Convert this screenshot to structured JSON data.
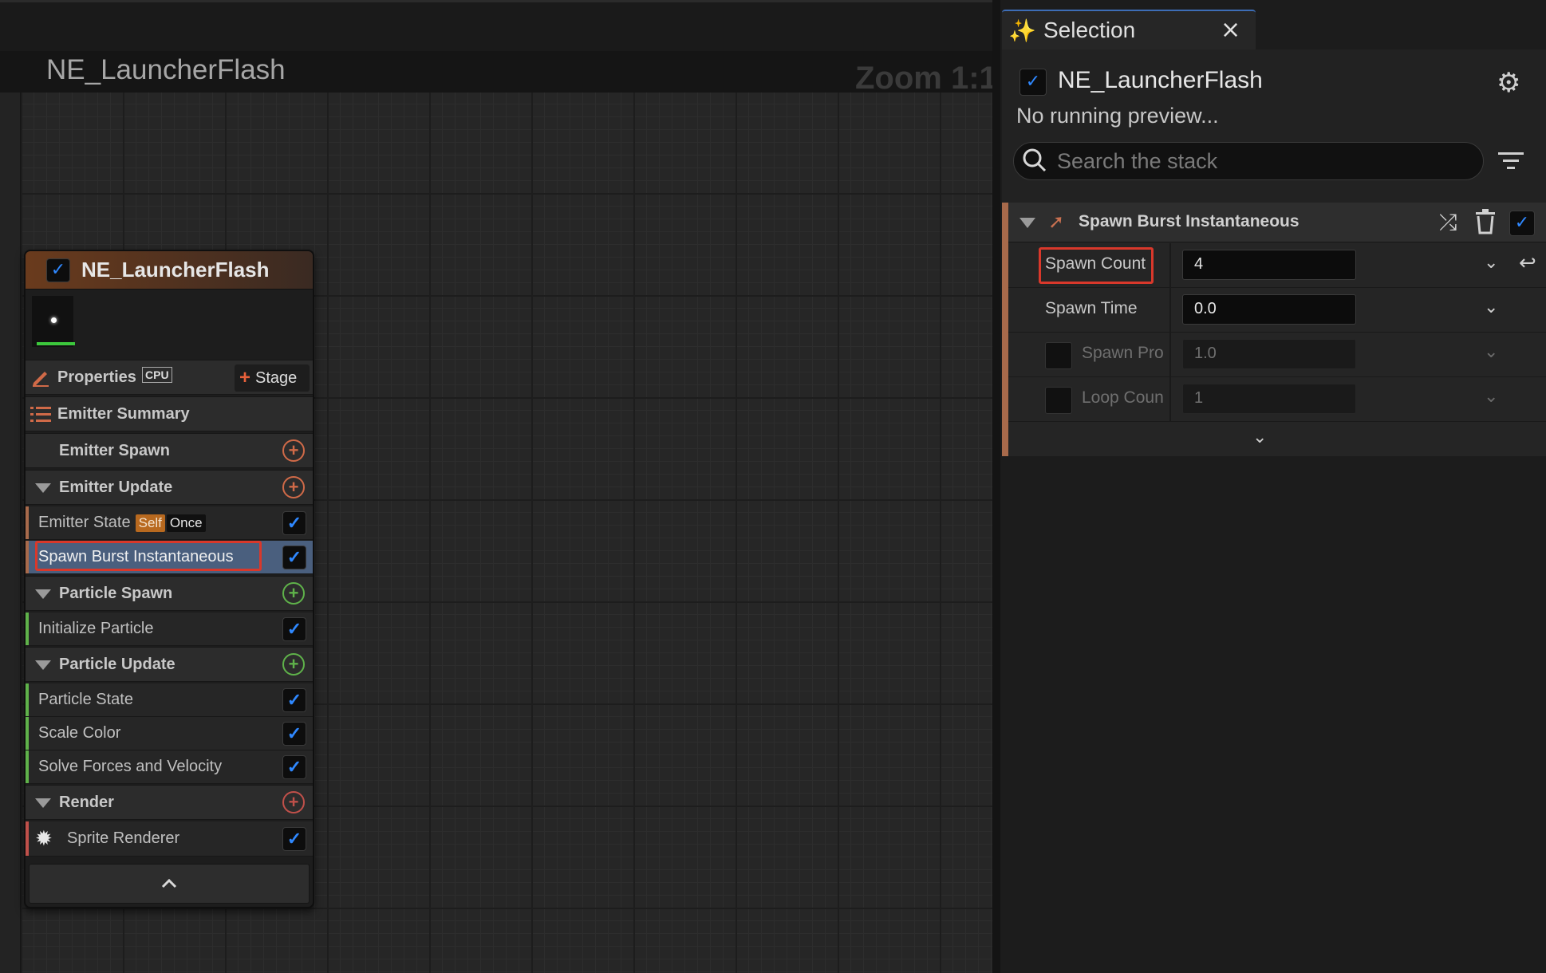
{
  "graph": {
    "title": "NE_LauncherFlash",
    "zoom": "Zoom 1:1"
  },
  "node": {
    "title": "NE_LauncherFlash",
    "properties_label": "Properties",
    "cpu_label": "CPU",
    "stage_label": "Stage",
    "emitter_summary": "Emitter Summary",
    "emitter_spawn": "Emitter Spawn",
    "emitter_update": "Emitter Update",
    "emitter_state": "Emitter State",
    "tag_self": "Self",
    "tag_once": "Once",
    "spawn_burst": "Spawn Burst Instantaneous",
    "particle_spawn": "Particle Spawn",
    "initialize_particle": "Initialize Particle",
    "particle_update": "Particle Update",
    "particle_state": "Particle State",
    "scale_color": "Scale Color",
    "solve_forces": "Solve Forces and Velocity",
    "render": "Render",
    "sprite_renderer": "Sprite Renderer"
  },
  "panel": {
    "tab_title": "Selection",
    "selected_name": "NE_LauncherFlash",
    "preview_status": "No running preview...",
    "search_placeholder": "Search the stack",
    "module_title": "Spawn Burst Instantaneous",
    "params": {
      "spawn_count": {
        "label": "Spawn Count",
        "value": "4"
      },
      "spawn_time": {
        "label": "Spawn Time",
        "value": "0.0"
      },
      "spawn_prob": {
        "label": "Spawn Pro",
        "value": "1.0"
      },
      "loop_count": {
        "label": "Loop Coun",
        "value": "1"
      }
    }
  },
  "colors": {
    "accent_blue": "#2f88ff",
    "emitter_orange": "#a86a4b",
    "particle_green": "#5fb24a",
    "render_red": "#c0504a",
    "highlight_red": "#d9382b"
  }
}
